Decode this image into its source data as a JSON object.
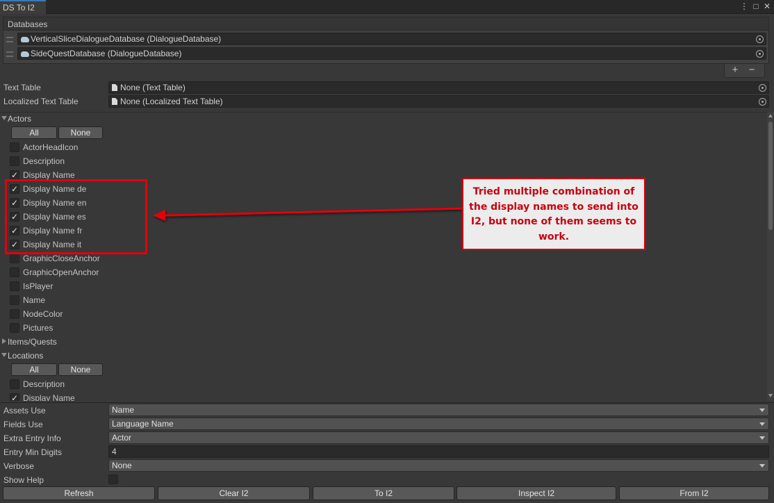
{
  "window": {
    "tab_title": "DS To I2",
    "menu_icon": "kebab-menu-icon",
    "maximize_icon": "maximize-icon",
    "close_icon": "close-icon",
    "menu_glyph": "⋮",
    "maximize_glyph": "□",
    "close_glyph": "✕"
  },
  "databases": {
    "header": "Databases",
    "items": [
      {
        "name": "VerticalSliceDialogueDatabase (DialogueDatabase)"
      },
      {
        "name": "SideQuestDatabase (DialogueDatabase)"
      }
    ],
    "add_label": "+",
    "remove_label": "−"
  },
  "text_table": {
    "label": "Text Table",
    "value": "None (Text Table)"
  },
  "localized_text_table": {
    "label": "Localized Text Table",
    "value": "None (Localized Text Table)"
  },
  "actors": {
    "label": "Actors",
    "expanded": true,
    "all_label": "All",
    "none_label": "None",
    "fields": [
      {
        "label": "ActorHeadIcon",
        "checked": false
      },
      {
        "label": "Description",
        "checked": false
      },
      {
        "label": "Display Name",
        "checked": true
      },
      {
        "label": "Display Name de",
        "checked": true
      },
      {
        "label": "Display Name en",
        "checked": true
      },
      {
        "label": "Display Name es",
        "checked": true
      },
      {
        "label": "Display Name fr",
        "checked": true
      },
      {
        "label": "Display Name it",
        "checked": true
      },
      {
        "label": "GraphicCloseAnchor",
        "checked": false
      },
      {
        "label": "GraphicOpenAnchor",
        "checked": false
      },
      {
        "label": "IsPlayer",
        "checked": false
      },
      {
        "label": "Name",
        "checked": false
      },
      {
        "label": "NodeColor",
        "checked": false
      },
      {
        "label": "Pictures",
        "checked": false
      }
    ]
  },
  "items_quests": {
    "label": "Items/Quests",
    "expanded": false
  },
  "locations": {
    "label": "Locations",
    "expanded": true,
    "all_label": "All",
    "none_label": "None",
    "fields": [
      {
        "label": "Description",
        "checked": false
      },
      {
        "label": "Display Name",
        "checked": true
      }
    ]
  },
  "options": {
    "assets_use": {
      "label": "Assets Use",
      "value": "Name"
    },
    "fields_use": {
      "label": "Fields Use",
      "value": "Language Name"
    },
    "extra_entry_info": {
      "label": "Extra Entry Info",
      "value": "Actor"
    },
    "entry_min_digits": {
      "label": "Entry Min Digits",
      "value": "4"
    },
    "verbose": {
      "label": "Verbose",
      "value": "None"
    },
    "show_help": {
      "label": "Show Help",
      "checked": false
    }
  },
  "actions": {
    "refresh": "Refresh",
    "clear_i2": "Clear I2",
    "to_i2": "To I2",
    "inspect_i2": "Inspect I2",
    "from_i2": "From I2"
  },
  "annotation": {
    "note": "Tried multiple combination of the display names to send into I2, but none of them seems to work.",
    "color": "#e3000d"
  }
}
